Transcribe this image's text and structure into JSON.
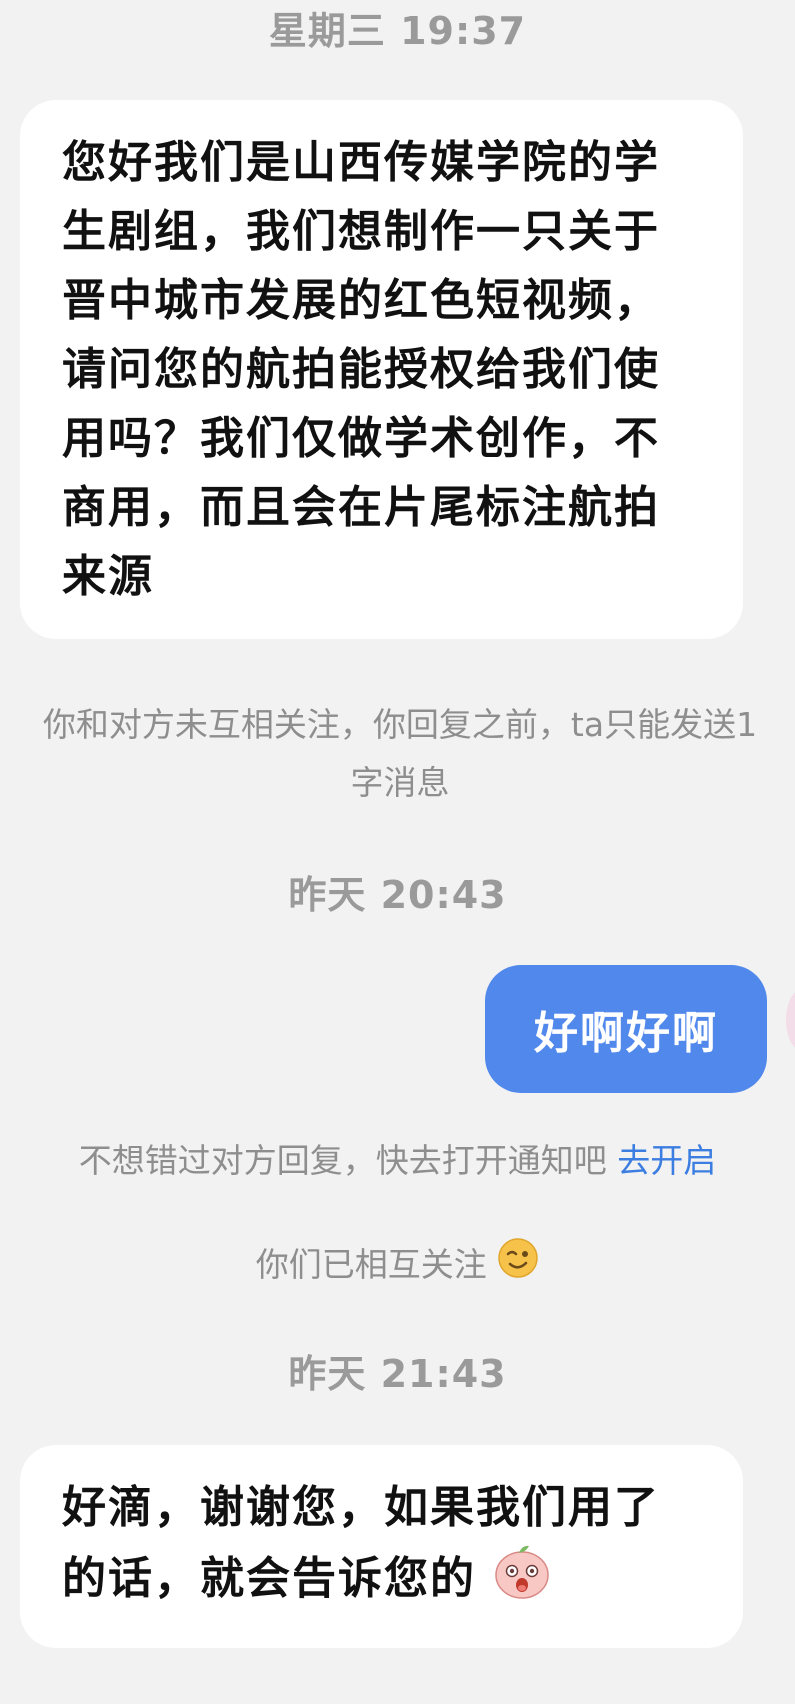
{
  "timestamps": {
    "t1": "星期三 19:37",
    "t2": "昨天 20:43",
    "t3": "昨天 21:43"
  },
  "messages": {
    "first": {
      "text": "您好我们是山西传媒学院的学生剧组，我们想制作一只关于晋中城市发展的红色短视频，请问您的航拍能授权给我们使用吗？我们仅做学术创作，不商用，而且会在片尾标注航拍来源"
    },
    "reply": {
      "text": "好啊好啊"
    },
    "last": {
      "text": "好滴，谢谢您，如果我们用了的话，就会告诉您的"
    }
  },
  "system": {
    "not_mutual_line1": "你和对方未互相关注，你回复之前，ta只能发送1",
    "not_mutual_line2": "字消息",
    "notify_prompt": "不想错过对方回复，快去打开通知吧",
    "notify_link": "去开启",
    "mutual_follow": "你们已相互关注"
  },
  "icons": {
    "wink": "wink-emoji-icon",
    "peach": "peach-face-sticker-icon"
  },
  "colors": {
    "background": "#f2f2f2",
    "bubble_incoming": "#ffffff",
    "bubble_outgoing": "#5088ec",
    "link": "#3b7de0",
    "system_text": "#8e8e8e"
  }
}
